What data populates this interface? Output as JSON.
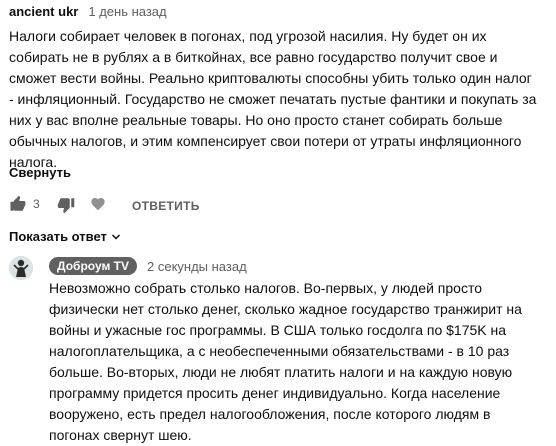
{
  "comment": {
    "author": "ancient ukr",
    "time": "1 день назад",
    "lines": [
      "Налоги собирает человек в погонах, под угрозой насилия. Ну будет он их",
      "собирать не в рублях а в биткойнах, все равно государство получит свое и",
      "сможет вести войны. Реально криптовалюты способны убить только один налог",
      "- инфляционный. Государство не сможет печатать пустые фантики и покупать за",
      "них у вас вполне реальные товары. Но оно просто станет собирать больше",
      "обычных налогов, и этим компенсирует свои потери от утраты инфляционного",
      "налога."
    ],
    "collapse_label": "Свернуть",
    "like_count": "3",
    "reply_label": "ОТВЕТИТЬ",
    "show_replies_label": "Показать ответ"
  },
  "reply": {
    "author": "Доброум TV",
    "time": "2 секунды назад",
    "lines": [
      "Невозможно собрать столько налогов. Во-первых, у людей просто",
      "физически нет столько денег, сколько жадное государство транжирит на",
      "войны и ужасные гос программы. В США только госдолга по $175K на",
      "налогоплательщика, а с необеспеченными обязательствами - в 10 раз",
      "больше. Во-вторых, люди не любят платить налоги и на каждую новую",
      "программу придется просить денег индивидуально. Когда население",
      "вооружено, есть предел налогообложения, после которого людям в",
      "погонах свернут шею."
    ]
  },
  "icons": {
    "like": "thumbs-up-icon",
    "dislike": "thumbs-down-icon",
    "heart": "heart-icon",
    "chevron": "chevron-down-icon",
    "avatar": "avatar-image"
  }
}
